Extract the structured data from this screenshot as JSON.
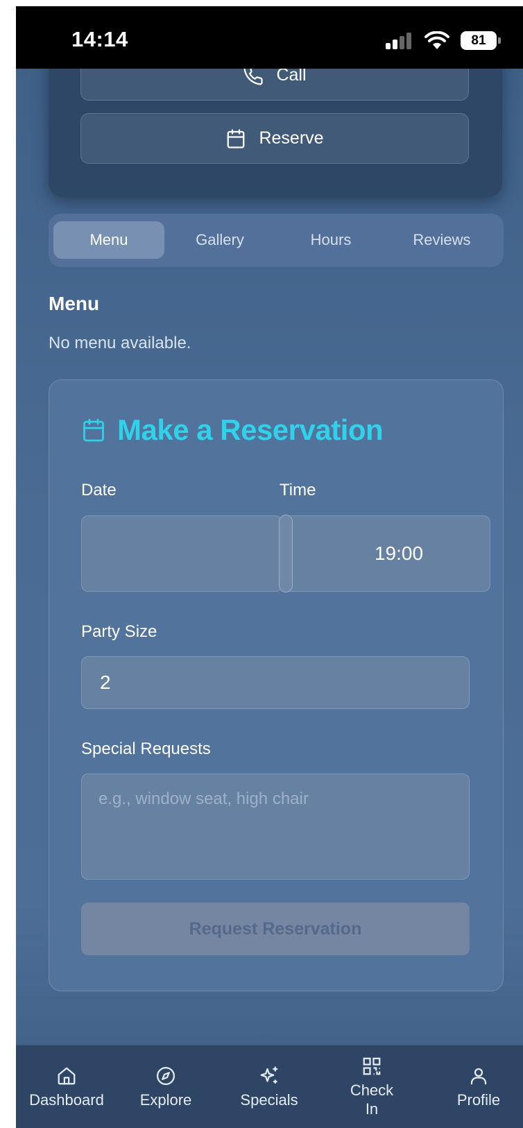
{
  "status_bar": {
    "time": "14:14",
    "battery": "81"
  },
  "actions": {
    "call_label": "Call",
    "reserve_label": "Reserve"
  },
  "tabs": [
    {
      "label": "Menu",
      "active": true
    },
    {
      "label": "Gallery",
      "active": false
    },
    {
      "label": "Hours",
      "active": false
    },
    {
      "label": "Reviews",
      "active": false
    }
  ],
  "menu_section": {
    "title": "Menu",
    "empty_text": "No menu available."
  },
  "reservation": {
    "title": "Make a Reservation",
    "date_label": "Date",
    "date_value": "",
    "time_label": "Time",
    "time_value": "19:00",
    "party_label": "Party Size",
    "party_value": "2",
    "requests_label": "Special Requests",
    "requests_placeholder": "e.g., window seat, high chair",
    "submit_label": "Request Reservation"
  },
  "bottom_nav": {
    "dashboard": "Dashboard",
    "explore": "Explore",
    "specials": "Specials",
    "checkin_line1": "Check",
    "checkin_line2": "In",
    "profile": "Profile"
  },
  "icons": {
    "call": "phone-icon",
    "reserve": "calendar-icon",
    "dashboard": "home-icon",
    "explore": "compass-icon",
    "specials": "sparkles-icon",
    "checkin": "qr-code-icon",
    "profile": "user-icon"
  },
  "colors": {
    "accent": "#2fd2ea",
    "background": "#4a6b93",
    "nav_background": "#2e4565"
  }
}
